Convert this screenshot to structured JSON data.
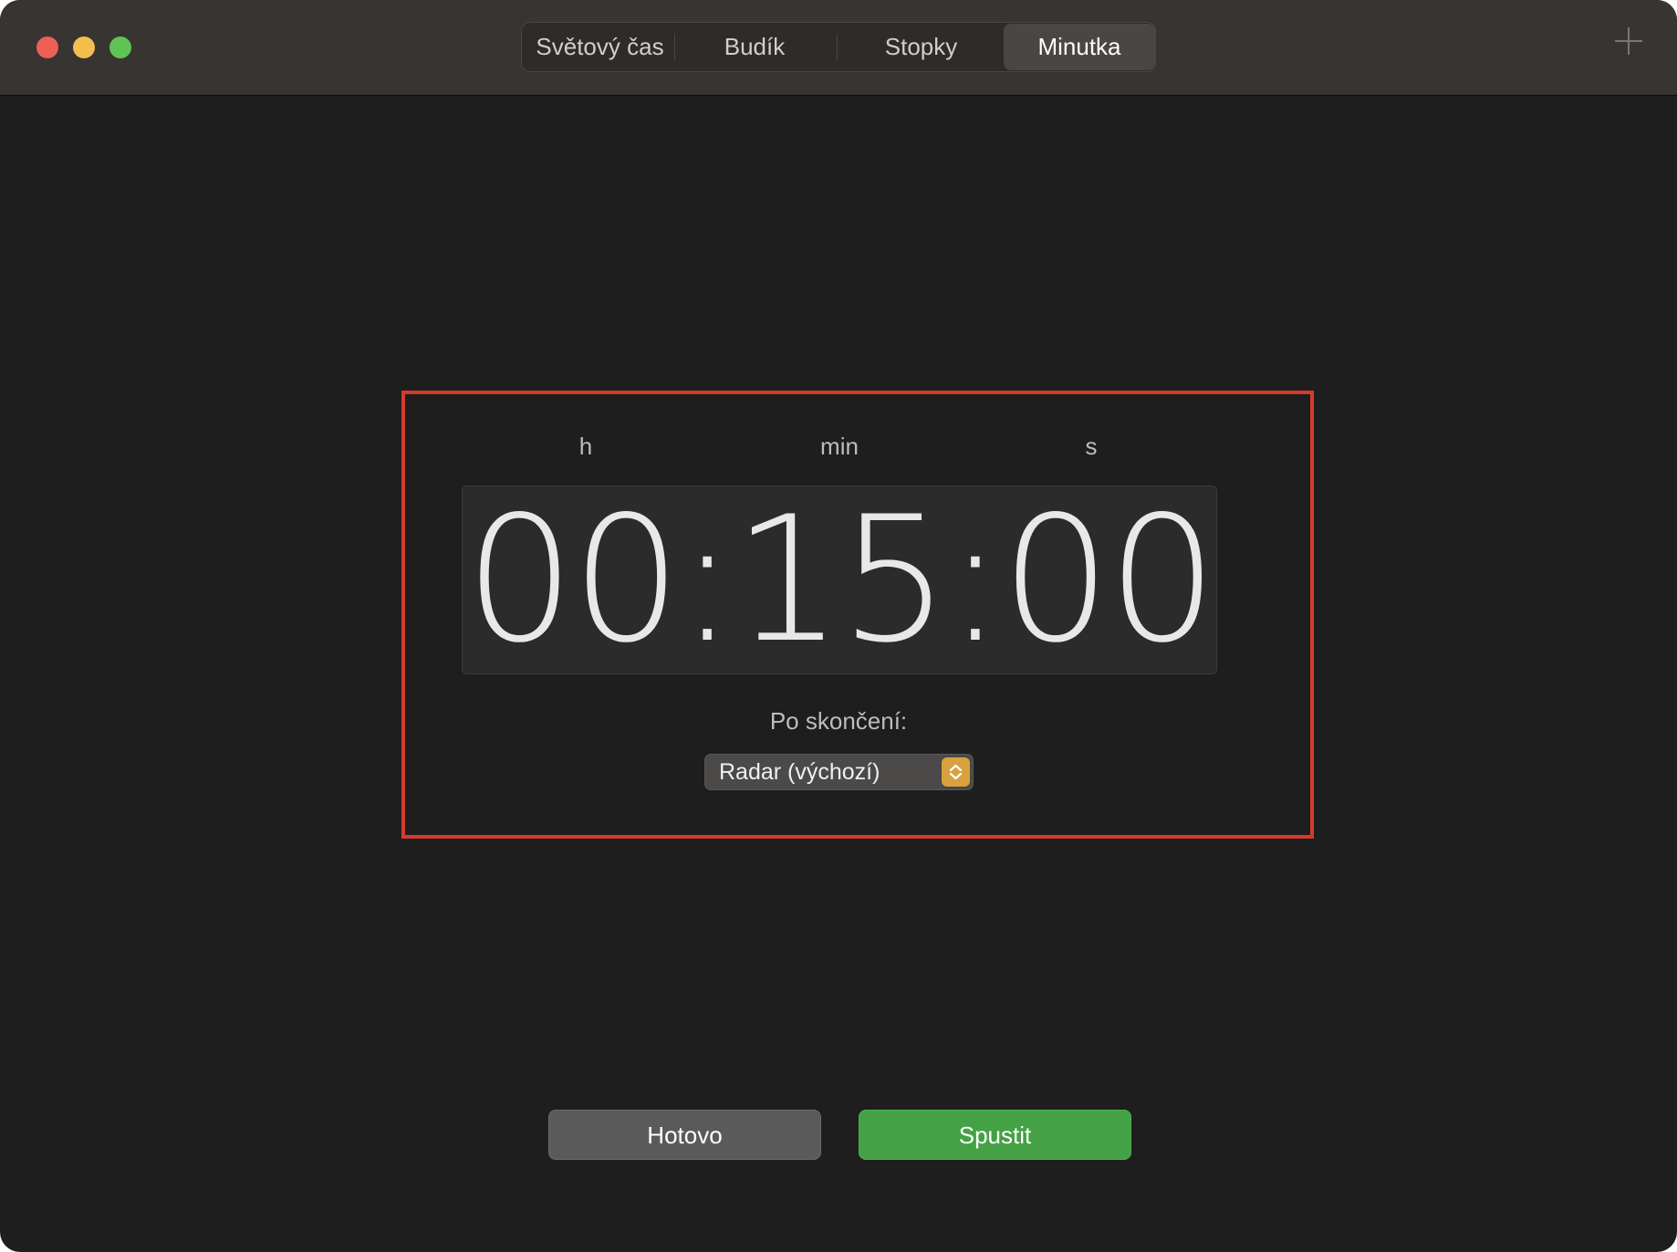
{
  "window": {
    "traffic_lights": [
      "close-button",
      "minimize-button",
      "zoom-button"
    ]
  },
  "tabs": [
    {
      "label": "Světový čas",
      "active": false
    },
    {
      "label": "Budík",
      "active": false
    },
    {
      "label": "Stopky",
      "active": false
    },
    {
      "label": "Minutka",
      "active": true
    }
  ],
  "toolbar": {
    "add_icon": "plus-icon"
  },
  "timer": {
    "unit_hours": "h",
    "unit_minutes": "min",
    "unit_seconds": "s",
    "display": "00:15:00",
    "when_done_label": "Po skončení:",
    "sound_selected": "Radar (výchozí)"
  },
  "buttons": {
    "done_label": "Hotovo",
    "start_label": "Spustit"
  },
  "colors": {
    "highlight_border": "#d63a2a",
    "start_button": "#44a145",
    "select_accent": "#d7a23e"
  }
}
